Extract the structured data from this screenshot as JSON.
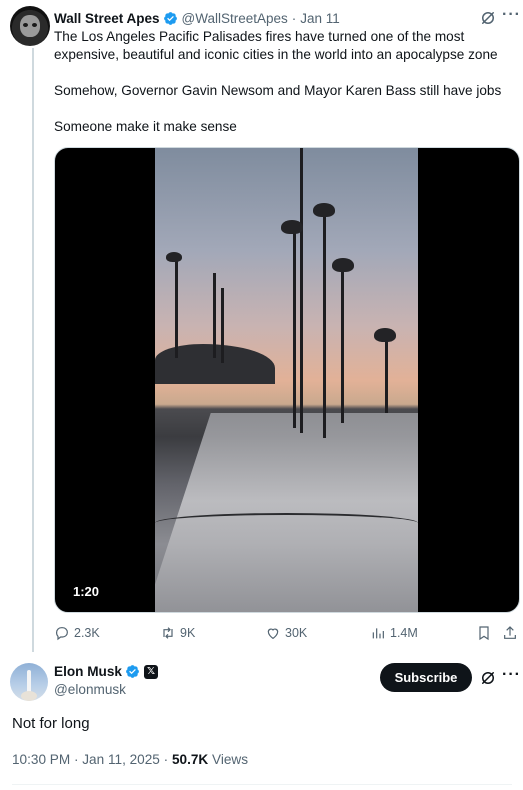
{
  "parent_tweet": {
    "author_name": "Wall Street Apes",
    "author_handle": "@WallStreetApes",
    "separator": "·",
    "date": "Jan 11",
    "text_paragraphs": [
      "The Los Angeles Pacific Palisades fires have turned one of the most expensive, beautiful and iconic cities in the world into an apocalypse zone",
      "Somehow, Governor Gavin Newsom and Mayor Karen Bass still have jobs",
      "Someone make it make sense"
    ],
    "video_duration": "1:20",
    "stats": {
      "replies": "2.3K",
      "reposts": "9K",
      "likes": "30K",
      "views": "1.4M"
    }
  },
  "main_tweet": {
    "author_name": "Elon Musk",
    "author_handle": "@elonmusk",
    "subscribe_label": "Subscribe",
    "text": "Not for long",
    "timestamp": "10:30 PM · Jan 11, 2025 · ",
    "views_count": "50.7K",
    "views_label": " Views"
  },
  "colors": {
    "verified_blue": "#1d9bf0",
    "secondary_text": "#536471",
    "primary_text": "#0f1419"
  },
  "icons": [
    "verified-icon",
    "grok-icon",
    "more-icon",
    "reply-icon",
    "repost-icon",
    "like-icon",
    "views-icon",
    "bookmark-icon",
    "share-icon",
    "x-affiliate-icon"
  ]
}
